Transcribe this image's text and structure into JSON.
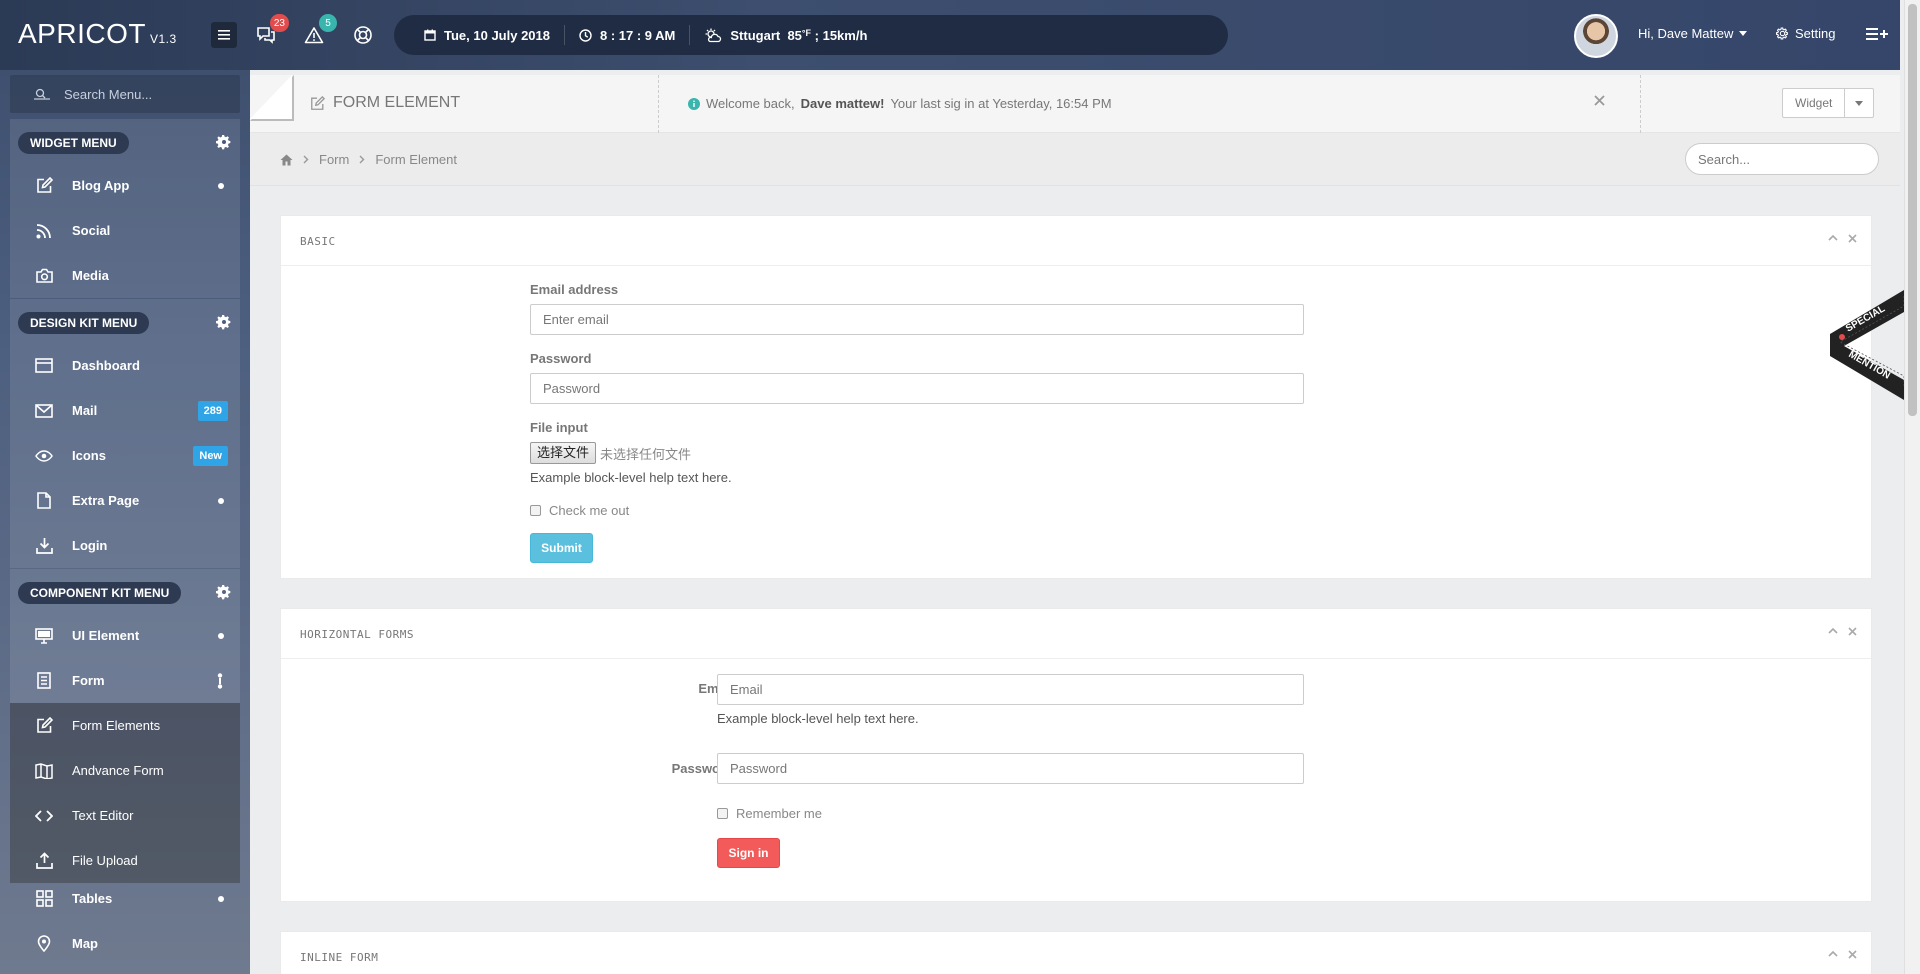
{
  "header": {
    "brand": "APRICOT",
    "version": "V1.3",
    "chat_badge": "23",
    "alert_badge": "5",
    "date": "Tue, 10 July 2018",
    "time": "8 : 17 : 9 AM",
    "weather_city": "Sttugart",
    "weather_temp": "85",
    "weather_unit": "°F",
    "weather_wind": "; 15km/h",
    "user_greeting": "Hi, Dave Mattew",
    "setting_label": "Setting"
  },
  "sidebar": {
    "search_placeholder": "Search Menu...",
    "groups": [
      {
        "title": "WIDGET MENU",
        "items": [
          {
            "label": "Blog App",
            "icon": "edit-icon"
          },
          {
            "label": "Social",
            "icon": "rss-icon"
          },
          {
            "label": "Media",
            "icon": "camera-icon"
          }
        ]
      },
      {
        "title": "DESIGN KIT MENU",
        "items": [
          {
            "label": "Dashboard",
            "icon": "window-icon"
          },
          {
            "label": "Mail",
            "icon": "mail-icon",
            "badge": "289"
          },
          {
            "label": "Icons",
            "icon": "eye-icon",
            "badge": "New"
          },
          {
            "label": "Extra Page",
            "icon": "file-icon"
          },
          {
            "label": "Login",
            "icon": "download-icon"
          }
        ]
      },
      {
        "title": "COMPONENT KIT MENU",
        "items": [
          {
            "label": "UI Element",
            "icon": "monitor-icon"
          },
          {
            "label": "Form",
            "icon": "form-icon"
          }
        ],
        "submenu": [
          {
            "label": "Form Elements",
            "icon": "edit-icon"
          },
          {
            "label": "Andvance Form",
            "icon": "map-book-icon"
          },
          {
            "label": "Text Editor",
            "icon": "code-icon"
          },
          {
            "label": "File Upload",
            "icon": "upload-icon"
          }
        ]
      }
    ],
    "extra_items": [
      {
        "label": "Tables",
        "icon": "grid-icon"
      },
      {
        "label": "Map",
        "icon": "map-pin-icon"
      }
    ]
  },
  "page": {
    "title": "FORM ELEMENT",
    "welcome_prefix": "Welcome back,",
    "welcome_name": "Dave mattew!",
    "welcome_suffix": "Your last sig in at Yesterday, 16:54 PM",
    "widget_label": "Widget",
    "breadcrumb": [
      "Form",
      "Form Element"
    ],
    "search_placeholder": "Search..."
  },
  "basic": {
    "title": "BASIC",
    "email_label": "Email address",
    "email_placeholder": "Enter email",
    "password_label": "Password",
    "password_placeholder": "Password",
    "file_label": "File input",
    "file_button": "选择文件",
    "file_status": "未选择任何文件",
    "help_text": "Example block-level help text here.",
    "check_label": "Check me out",
    "submit_label": "Submit"
  },
  "horizontal": {
    "title": "HORIZONTAL FORMS",
    "email_label": "Email",
    "email_placeholder": "Email",
    "help_text": "Example block-level help text here.",
    "password_label": "Password",
    "password_placeholder": "Password",
    "remember_label": "Remember me",
    "signin_label": "Sign in"
  },
  "inline": {
    "title": "INLINE FORM"
  },
  "ribbon": {
    "line1": "SPECIAL",
    "line2": "MENTION"
  },
  "colors": {
    "accent_info": "#5bc0de",
    "accent_danger": "#f35b5b",
    "badge_blue": "#2fa4e7",
    "badge_red": "#e24c4c",
    "badge_teal": "#39b5ad"
  }
}
